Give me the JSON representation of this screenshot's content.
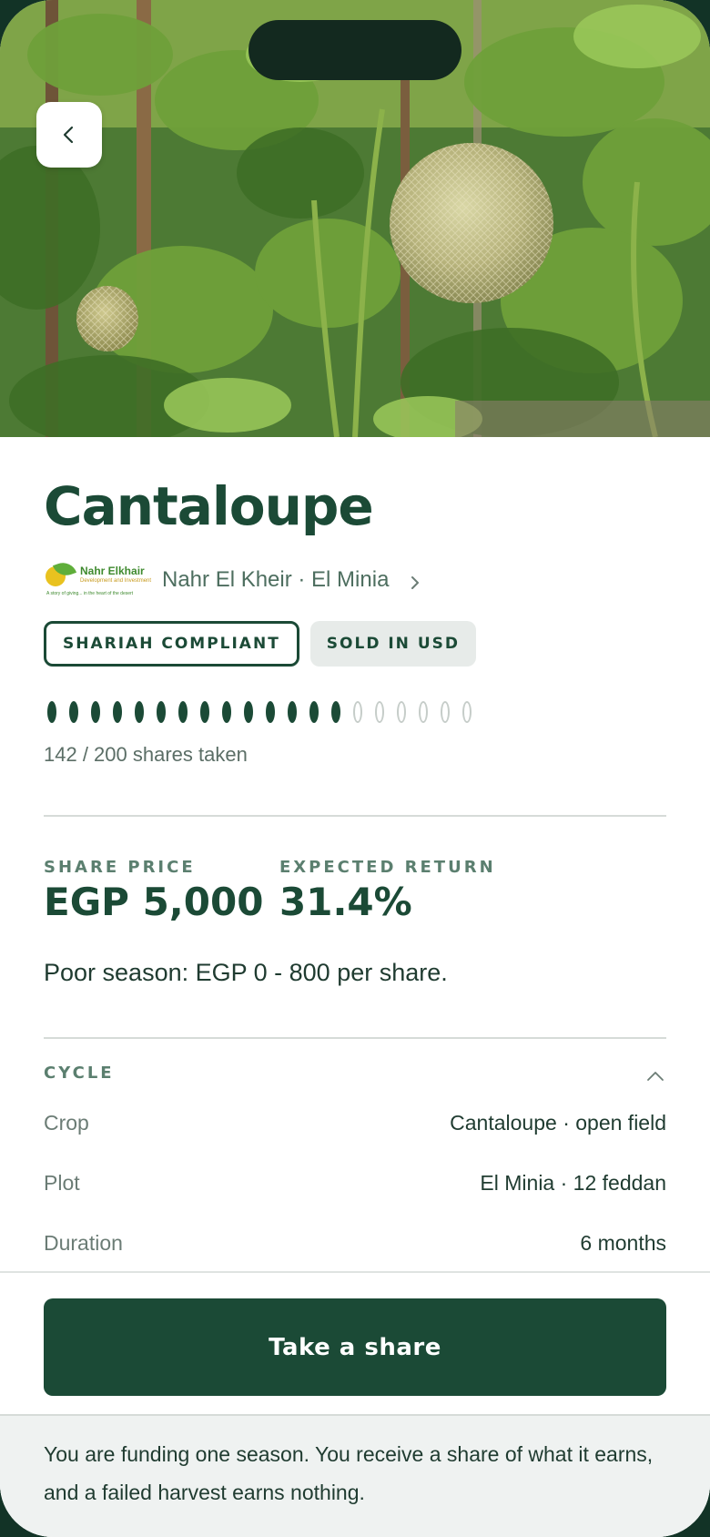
{
  "product": {
    "title": "Cantaloupe",
    "seller_name": "Nahr El Kheir · El Minia",
    "logo": {
      "name": "Nahr Elkhair",
      "tagline": "Development and Investment",
      "motto": "A story of giving... in the heart of the desert"
    }
  },
  "badges": {
    "shariah": "SHARIAH COMPLIANT",
    "usd": "SOLD IN USD"
  },
  "shares": {
    "taken": 142,
    "total": 200,
    "text": "142 / 200 shares taken",
    "pips_filled": 14,
    "pips_total": 20
  },
  "stats": {
    "share_price_label": "SHARE PRICE",
    "share_price_value": "EGP 5,000",
    "expected_return_label": "EXPECTED RETURN",
    "expected_return_value": "31.4%"
  },
  "poor_season": "Poor season: EGP 0 - 800 per share.",
  "cycle": {
    "title": "CYCLE",
    "rows": [
      {
        "key": "Crop",
        "value": "Cantaloupe · open field"
      },
      {
        "key": "Plot",
        "value": "El Minia · 12 feddan"
      },
      {
        "key": "Duration",
        "value": "6 months"
      }
    ]
  },
  "cta": {
    "label": "Take a share"
  },
  "note": "You are funding one season. You receive a share of what it earns, and a failed harvest earns nothing.",
  "icons": {
    "back": "chevron-left-icon",
    "seller": "chevron-right-icon",
    "cycle": "chevron-up-icon"
  },
  "colors": {
    "brand": "#1b4a36",
    "muted": "#5b7f6f",
    "badge_bg": "#e7ebe9",
    "note_bg": "#eff2f1"
  }
}
